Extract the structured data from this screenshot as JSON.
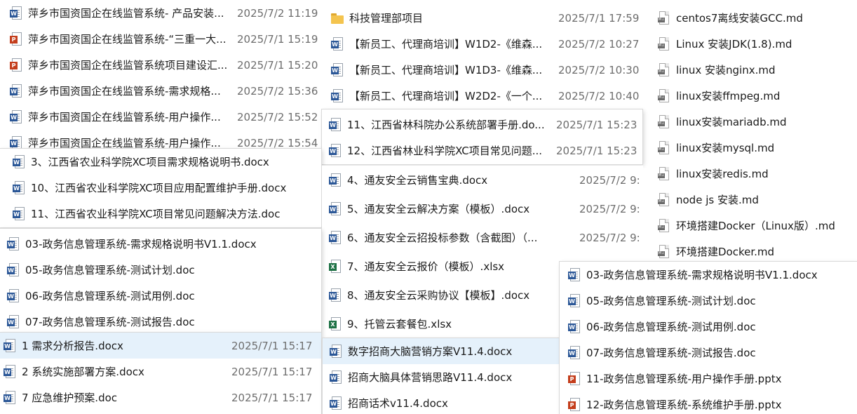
{
  "panel_a": {
    "rows": [
      {
        "icon": "word",
        "name": "萍乡市国资国企在线监管系统- 产品安装...",
        "date": "2025/7/2 11:19"
      },
      {
        "icon": "ppt",
        "name": "萍乡市国资国企在线监管系统-“三重一大...",
        "date": "2025/7/1 15:19"
      },
      {
        "icon": "ppt",
        "name": "萍乡市国资国企在线监管系统项目建设汇...",
        "date": "2025/7/1 15:20"
      },
      {
        "icon": "word",
        "name": "萍乡市国资国企在线监管系统-需求规格...",
        "date": "2025/7/2 15:36"
      },
      {
        "icon": "word",
        "name": "萍乡市国资国企在线监管系统-用户操作...",
        "date": "2025/7/2 15:52"
      },
      {
        "icon": "word",
        "name": "萍乡市国资国企在线监管系统-用户操作...",
        "date": "2025/7/2 15:54"
      }
    ]
  },
  "panel_b": {
    "rows": [
      {
        "icon": "word",
        "name": "3、江西省农业科学院XC项目需求规格说明书.docx"
      },
      {
        "icon": "word",
        "name": "10、江西省农业科学院XC项目应用配置维护手册.docx"
      },
      {
        "icon": "word",
        "name": "11、江西省农业科学院XC项目常见问题解决方法.doc"
      }
    ]
  },
  "panel_c": {
    "rows": [
      {
        "icon": "word",
        "name": "03-政务信息管理系统-需求规格说明书V1.1.docx"
      },
      {
        "icon": "word",
        "name": "05-政务信息管理系统-测试计划.doc"
      },
      {
        "icon": "word",
        "name": "06-政务信息管理系统-测试用例.doc"
      },
      {
        "icon": "word",
        "name": "07-政务信息管理系统-测试报告.doc"
      }
    ]
  },
  "panel_d": {
    "rows": [
      {
        "icon": "word",
        "name": "1 需求分析报告.docx",
        "date": "2025/7/1 15:17",
        "selected": true
      },
      {
        "icon": "word",
        "name": "2 系统实施部署方案.docx",
        "date": "2025/7/1 15:17"
      },
      {
        "icon": "word",
        "name": "7 应急维护预案.doc",
        "date": "2025/7/1 15:17"
      }
    ]
  },
  "panel_e": {
    "rows": [
      {
        "icon": "folder",
        "name": "科技管理部项目",
        "date": "2025/7/1 17:59"
      },
      {
        "icon": "word",
        "name": "【新员工、代理商培训】W1D2-《维森...",
        "date": "2025/7/2 10:27"
      },
      {
        "icon": "word",
        "name": "【新员工、代理商培训】W1D3-《维森...",
        "date": "2025/7/2 10:30"
      },
      {
        "icon": "word",
        "name": "【新员工、代理商培训】W2D2-《一个...",
        "date": "2025/7/2 10:40"
      }
    ]
  },
  "panel_f": {
    "rows": [
      {
        "icon": "word",
        "name": "11、江西省林科院办公系统部署手册.do...",
        "date": "2025/7/1 15:23"
      },
      {
        "icon": "word",
        "name": "12、江西省林业科学院XC项目常见问题...",
        "date": "2025/7/1 15:23"
      }
    ]
  },
  "panel_g": {
    "rows": [
      {
        "icon": "word",
        "name": "4、通友安全云销售宝典.docx",
        "date": "2025/7/2 9:"
      },
      {
        "icon": "word",
        "name": "5、通友安全云解决方案（模板）.docx",
        "date": "2025/7/2 9:"
      },
      {
        "icon": "word",
        "name": "6、通友安全云招投标参数（含截图）（...",
        "date": "2025/7/2 9:"
      },
      {
        "icon": "xls",
        "name": "7、通友安全云报价（模板）.xlsx"
      },
      {
        "icon": "word",
        "name": "8、通友安全云采购协议【模板】.docx"
      },
      {
        "icon": "xls",
        "name": "9、托管云套餐包.xlsx"
      }
    ]
  },
  "panel_h": {
    "rows": [
      {
        "icon": "word",
        "name": "数字招商大脑营销方案V11.4.docx",
        "selected": true
      },
      {
        "icon": "word",
        "name": "招商大脑具体营销思路V11.4.docx"
      },
      {
        "icon": "word",
        "name": "招商话术v11.4.docx"
      }
    ]
  },
  "panel_i": {
    "rows": [
      {
        "icon": "md",
        "name": "centos7离线安装GCC.md"
      },
      {
        "icon": "md",
        "name": "Linux 安装JDK(1.8).md"
      },
      {
        "icon": "md",
        "name": "linux 安装nginx.md"
      },
      {
        "icon": "md",
        "name": "linux安装ffmpeg.md"
      },
      {
        "icon": "md",
        "name": "linux安装mariadb.md"
      },
      {
        "icon": "md",
        "name": "linux安装mysql.md"
      },
      {
        "icon": "md",
        "name": "linux安装redis.md"
      },
      {
        "icon": "md",
        "name": "node js 安装.md"
      },
      {
        "icon": "md",
        "name": "环境搭建Docker（Linux版）.md"
      },
      {
        "icon": "md",
        "name": "环境搭建Docker.md"
      }
    ]
  },
  "panel_j": {
    "rows": [
      {
        "icon": "word",
        "name": "03-政务信息管理系统-需求规格说明书V1.1.docx"
      },
      {
        "icon": "word",
        "name": "05-政务信息管理系统-测试计划.doc"
      },
      {
        "icon": "word",
        "name": "06-政务信息管理系统-测试用例.doc"
      },
      {
        "icon": "word",
        "name": "07-政务信息管理系统-测试报告.doc"
      },
      {
        "icon": "ppt",
        "name": "11-政务信息管理系统-用户操作手册.pptx"
      },
      {
        "icon": "ppt",
        "name": "12-政务信息管理系统-系统维护手册.pptx"
      }
    ]
  },
  "icon_colors": {
    "word": "#2b5797",
    "ppt": "#c43e1c",
    "xls": "#1e7145",
    "folder": "#f4c44e",
    "md": "#6a6a6a"
  },
  "badges": {
    "word": "W",
    "ppt": "P",
    "xls": "X",
    "md": "M↓"
  }
}
